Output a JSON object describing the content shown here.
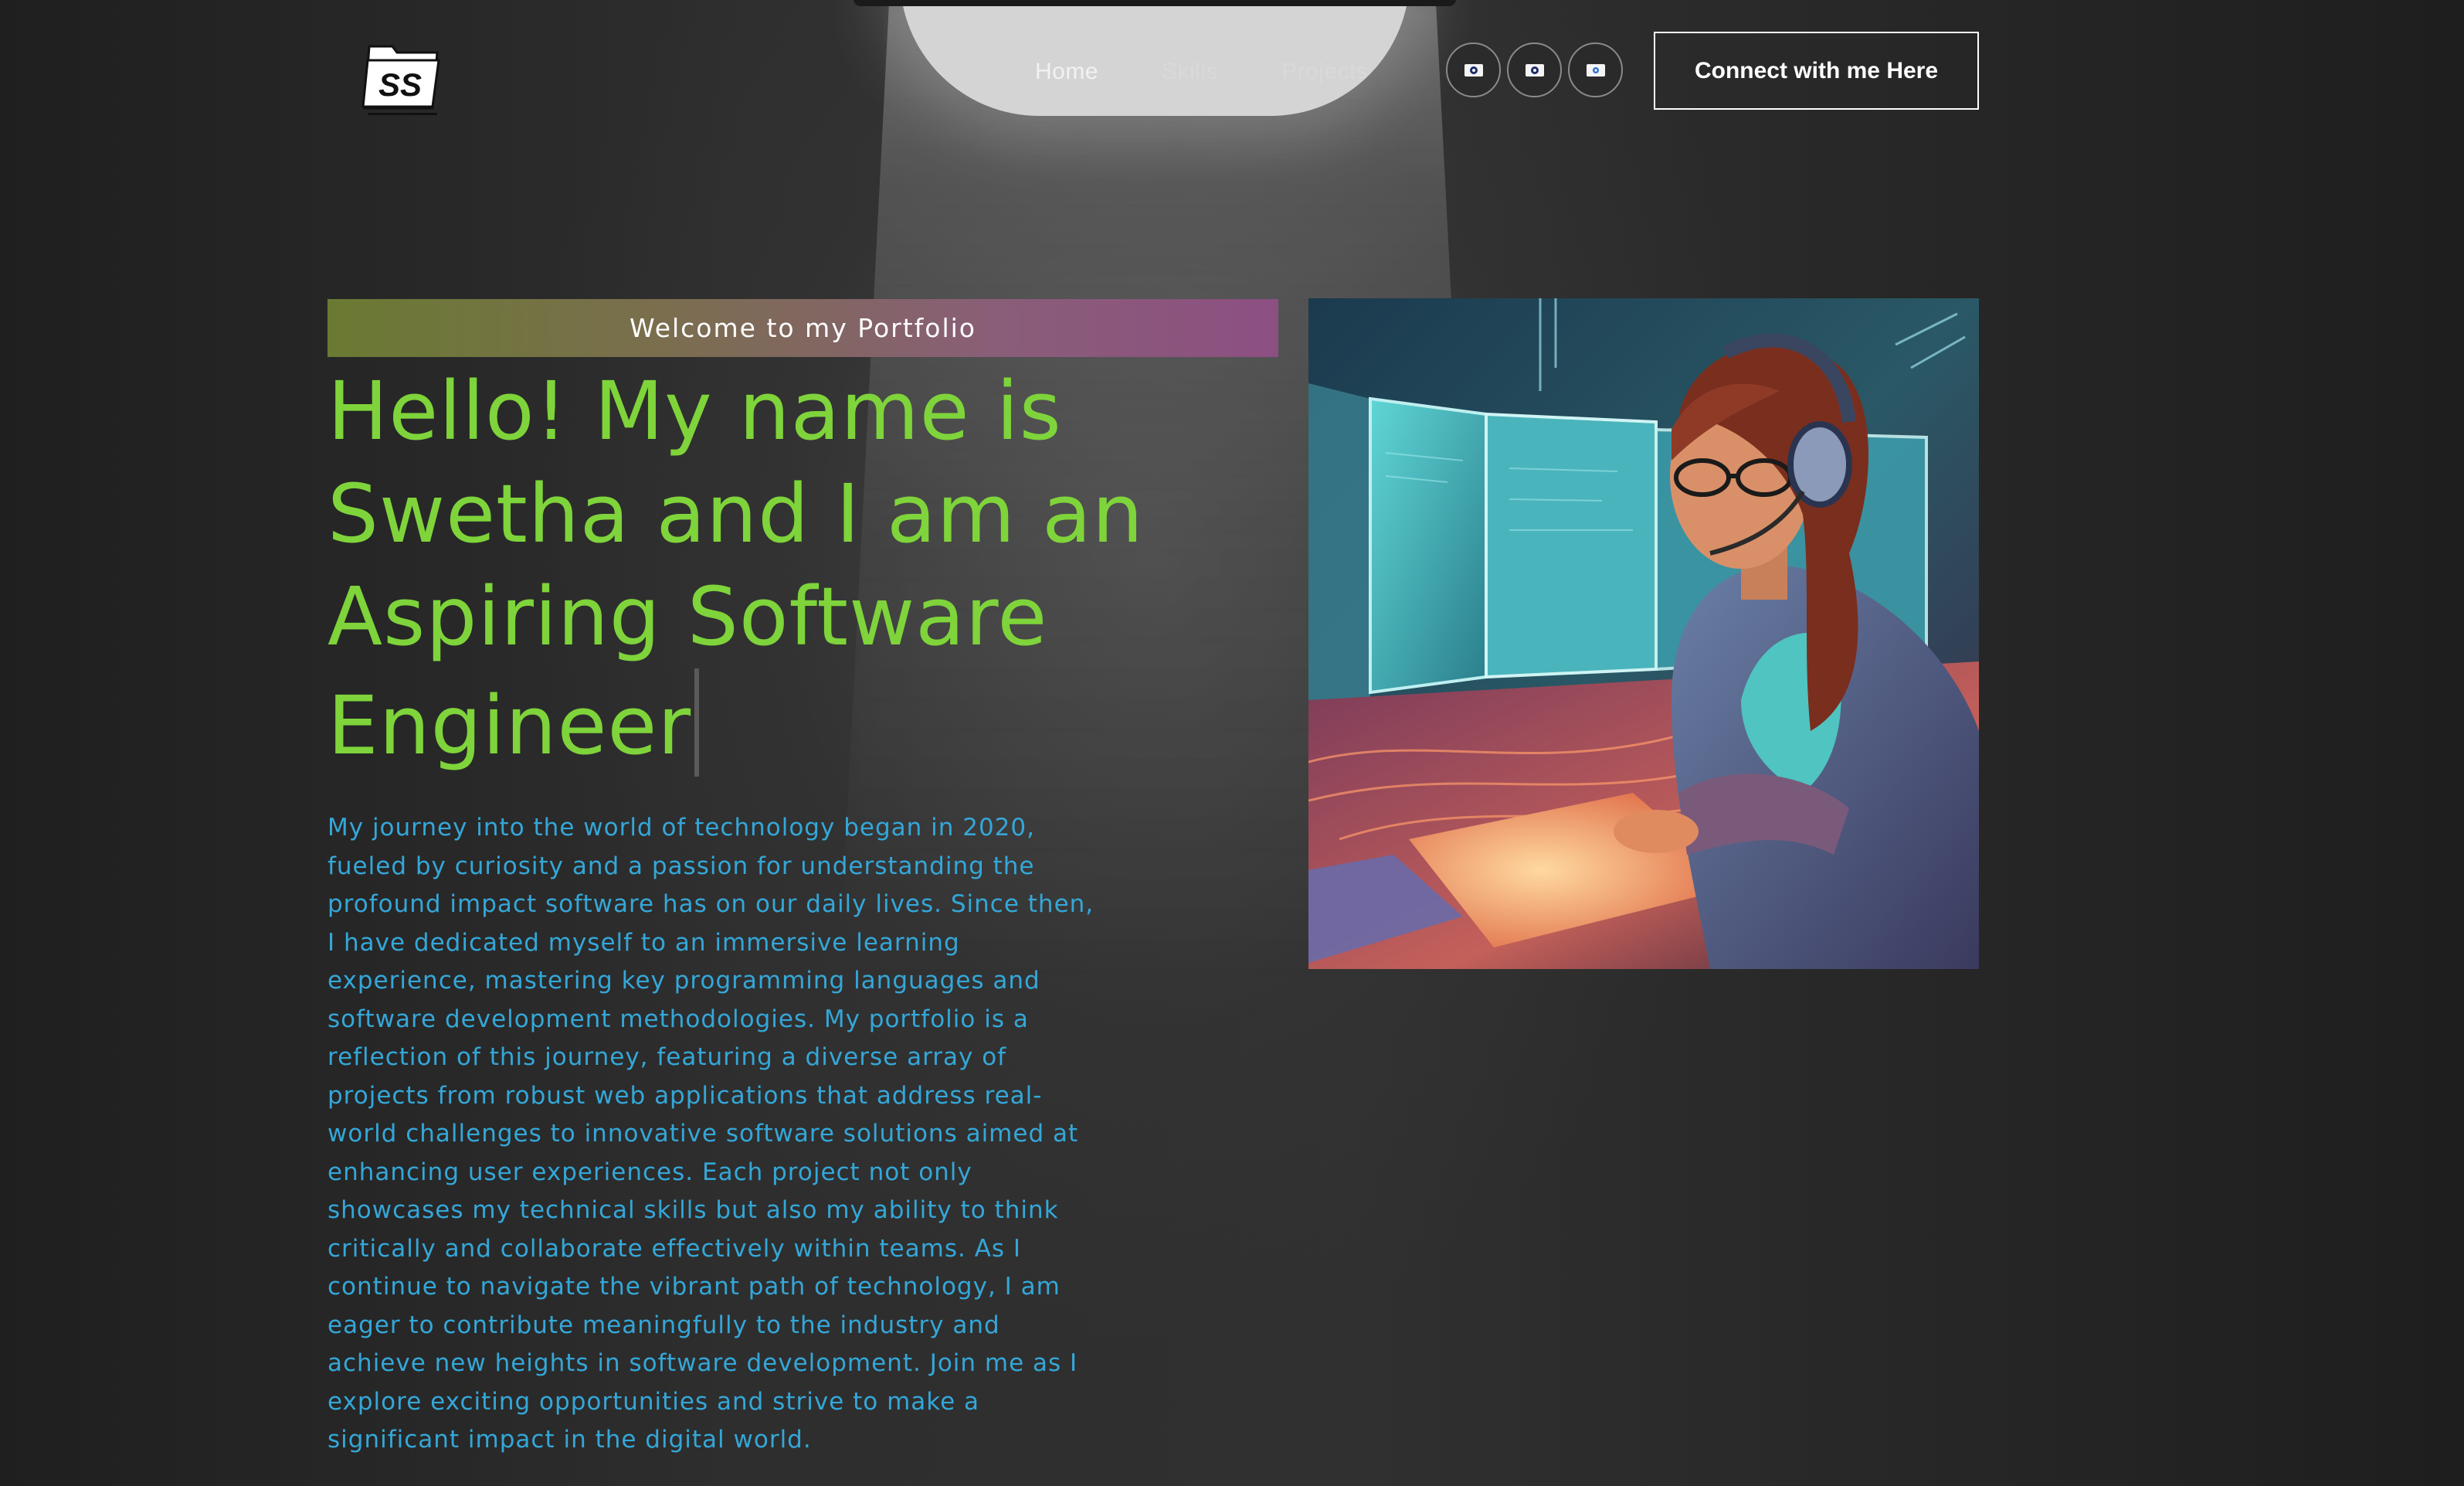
{
  "nav": {
    "logo_alt": "SS logo",
    "logo_text": "SS",
    "links": [
      {
        "label": "Home"
      },
      {
        "label": "Skills"
      },
      {
        "label": "Projects"
      }
    ],
    "social_icons": [
      "linkedin-icon",
      "facebook-icon",
      "instagram-icon"
    ],
    "connect_label": "Connect with me Here"
  },
  "hero": {
    "tagline": "Welcome to my Portfolio",
    "headline": "Hello! My name is Swetha and I am an Aspiring Software Engineer",
    "about": "My journey into the world of technology began in 2020, fueled by curiosity and a passion for understanding the profound impact software has on our daily lives. Since then, I have dedicated myself to an immersive learning experience, mastering key programming languages and software development methodologies. My portfolio is a reflection of this journey, featuring a diverse array of projects from robust web applications that address real-world challenges to innovative software solutions aimed at enhancing user experiences. Each project not only showcases my technical skills but also my ability to think critically and collaborate effectively within teams. As I continue to navigate the vibrant path of technology, I am eager to contribute meaningfully to the industry and achieve new heights in software development. Join me as I explore exciting opportunities and strive to make a significant impact in the digital world."
  },
  "colors": {
    "headline": "#7ed43a",
    "about_text": "#34a7d8",
    "banner_start": "#6a7a32",
    "banner_end": "#8c4f82",
    "background": "#2a2a2a"
  }
}
